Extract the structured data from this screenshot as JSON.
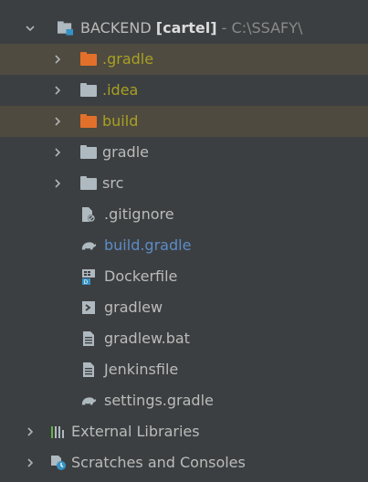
{
  "tree": {
    "root": {
      "name": "BACKEND",
      "module": "[cartel]",
      "path": "- C:\\SSAFY\\"
    },
    "children": [
      {
        "label": ".gradle",
        "kind": "folder",
        "state": "ignored"
      },
      {
        "label": ".idea",
        "kind": "folder",
        "state": "ignored"
      },
      {
        "label": "build",
        "kind": "folder",
        "state": "ignored"
      },
      {
        "label": "gradle",
        "kind": "folder",
        "state": "normal"
      },
      {
        "label": "src",
        "kind": "folder",
        "state": "normal"
      },
      {
        "label": ".gitignore",
        "kind": "file",
        "icon": "gitignore-icon"
      },
      {
        "label": "build.gradle",
        "kind": "file",
        "icon": "gradle-icon"
      },
      {
        "label": "Dockerfile",
        "kind": "file",
        "icon": "docker-icon"
      },
      {
        "label": "gradlew",
        "kind": "file",
        "icon": "shell-icon"
      },
      {
        "label": "gradlew.bat",
        "kind": "file",
        "icon": "text-file-icon"
      },
      {
        "label": "Jenkinsfile",
        "kind": "file",
        "icon": "text-file-icon"
      },
      {
        "label": "settings.gradle",
        "kind": "file",
        "icon": "gradle-icon"
      }
    ],
    "external_libraries": "External Libraries",
    "scratches": "Scratches and Consoles"
  }
}
